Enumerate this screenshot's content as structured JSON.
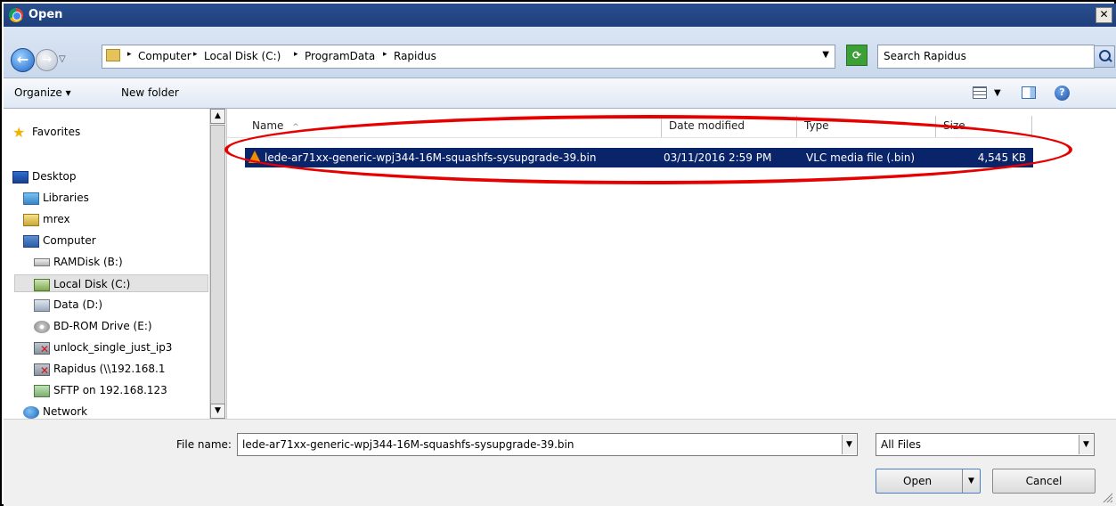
{
  "window": {
    "title": "Open",
    "close_glyph": "✕"
  },
  "address_bar": {
    "breadcrumbs": [
      "Computer",
      "Local Disk (C:)",
      "ProgramData",
      "Rapidus"
    ],
    "search_placeholder": "Search Rapidus"
  },
  "toolbar": {
    "organize_label": "Organize ▾",
    "new_folder_label": "New folder"
  },
  "navigation": {
    "items": [
      {
        "label": "Favorites",
        "icon": "star-icon"
      },
      {
        "label": "Desktop",
        "icon": "desktop-icon"
      },
      {
        "label": "Libraries",
        "icon": "libraries-icon"
      },
      {
        "label": "mrex",
        "icon": "user-folder-icon"
      },
      {
        "label": "Computer",
        "icon": "computer-icon"
      },
      {
        "label": "RAMDisk (B:)",
        "icon": "drive-icon"
      },
      {
        "label": "Local Disk (C:)",
        "icon": "local-disk-icon",
        "selected": true
      },
      {
        "label": "Data (D:)",
        "icon": "data-drive-icon"
      },
      {
        "label": "BD-ROM Drive (E:)",
        "icon": "cdrom-icon"
      },
      {
        "label": "unlock_single_just_ip3",
        "icon": "disconnected-network-drive-icon"
      },
      {
        "label": "Rapidus (\\\\192.168.1",
        "icon": "disconnected-network-drive-icon"
      },
      {
        "label": "SFTP on 192.168.123",
        "icon": "network-drive-icon"
      },
      {
        "label": "Network",
        "icon": "network-icon"
      }
    ]
  },
  "file_list": {
    "columns": [
      "Name",
      "Date modified",
      "Type",
      "Size"
    ],
    "sort_indicator": "^",
    "rows": [
      {
        "name": "lede-ar71xx-generic-wpj344-16M-squashfs-sysupgrade-39.bin",
        "date_modified": "03/11/2016 2:59 PM",
        "type": "VLC media file (.bin)",
        "size": "4,545 KB",
        "selected": true,
        "icon": "vlc-icon"
      }
    ]
  },
  "bottom": {
    "filename_label": "File name:",
    "filename_value": "lede-ar71xx-generic-wpj344-16M-squashfs-sysupgrade-39.bin",
    "filter_value": "All Files",
    "open_label": "Open",
    "cancel_label": "Cancel"
  },
  "colors": {
    "selection": "#0a246a",
    "annotation": "#e60000",
    "titlebar": "#1e3f7a"
  }
}
